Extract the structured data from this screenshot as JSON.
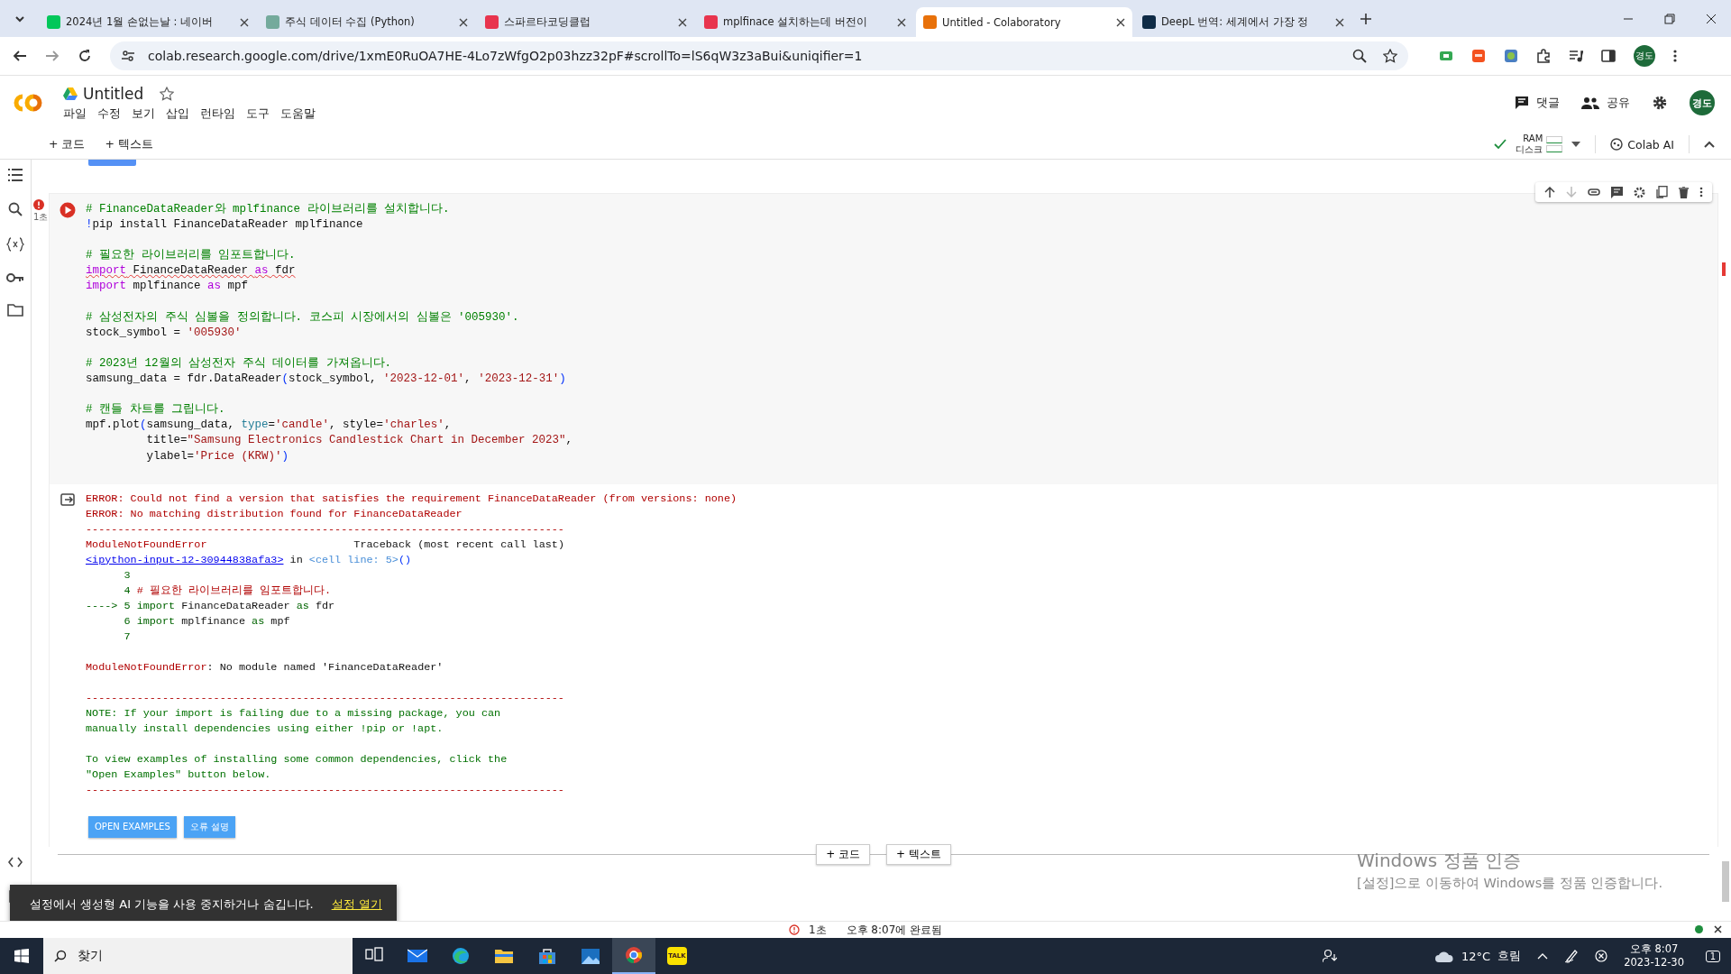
{
  "browser": {
    "tabs": [
      {
        "title": "2024년 1월 손없는날 : 네이버",
        "selected": false,
        "color": "#03c75a"
      },
      {
        "title": "주식 데이터 수집 (Python)",
        "selected": false,
        "color": "#74aa9c"
      },
      {
        "title": "스파르타코딩클럽",
        "selected": false,
        "color": "#e8344e"
      },
      {
        "title": "mplfinace 설치하는데 버전이",
        "selected": false,
        "color": "#e8344e"
      },
      {
        "title": "Untitled - Colaboratory",
        "selected": true,
        "color": "#e8710a"
      },
      {
        "title": "DeepL 번역: 세계에서 가장 정",
        "selected": false,
        "color": "#0f2b46"
      }
    ],
    "url": "colab.research.google.com/drive/1xmE0RuOA7HE-4Lo7zWfgO2p03hzz32pF#scrollTo=lS6qW3z3aBui&uniqifier=1",
    "profile": "경도"
  },
  "notebook": {
    "title": "Untitled",
    "starred": false,
    "menu": [
      "파일",
      "수정",
      "보기",
      "삽입",
      "런타임",
      "도구",
      "도움말"
    ],
    "comment": "댓글",
    "share": "공유",
    "avatar": "경도"
  },
  "toolbar": {
    "add_code": "+ 코드",
    "add_text": "+ 텍스트",
    "ram": "RAM",
    "disk": "디스크",
    "connected": true,
    "ai": "Colab AI"
  },
  "cell": {
    "status": "1초",
    "has_error": true,
    "blocks": [
      [
        [
          {
            "kind": "comment",
            "text": "# FinanceDataReader와 mplfinance 라이브러리를 설치합니다."
          }
        ],
        [
          {
            "kind": "bang",
            "text": "!"
          },
          {
            "kind": "plain",
            "text": "pip install FinanceDataReader mplfinance"
          }
        ]
      ],
      [
        [
          {
            "kind": "comment",
            "text": "# 필요한 라이브러리를 임포트합니다."
          }
        ],
        [
          {
            "kind": "keyword",
            "text": "import",
            "squiggle": true
          },
          {
            "kind": "plain",
            "text": " FinanceDataReader ",
            "squiggle": true
          },
          {
            "kind": "keyword",
            "text": "as",
            "squiggle": true
          },
          {
            "kind": "plain",
            "text": " fdr",
            "squiggle": true
          }
        ],
        [
          {
            "kind": "keyword",
            "text": "import"
          },
          {
            "kind": "plain",
            "text": " mplfinance "
          },
          {
            "kind": "keyword",
            "text": "as"
          },
          {
            "kind": "plain",
            "text": " mpf"
          }
        ]
      ],
      [
        [
          {
            "kind": "comment",
            "text": "# 삼성전자의 주식 심볼을 정의합니다. 코스피 시장에서의 심볼은 '005930'."
          }
        ],
        [
          {
            "kind": "plain",
            "text": "stock_symbol = "
          },
          {
            "kind": "string",
            "text": "'005930'"
          }
        ]
      ],
      [
        [
          {
            "kind": "comment",
            "text": "# 2023년 12월의 삼성전자 주식 데이터를 가져옵니다."
          }
        ],
        [
          {
            "kind": "plain",
            "text": "samsung_data = fdr.DataReader"
          },
          {
            "kind": "paren",
            "text": "("
          },
          {
            "kind": "plain",
            "text": "stock_symbol, "
          },
          {
            "kind": "string",
            "text": "'2023-12-01'"
          },
          {
            "kind": "plain",
            "text": ", "
          },
          {
            "kind": "string",
            "text": "'2023-12-31'"
          },
          {
            "kind": "paren",
            "text": ")"
          }
        ]
      ],
      [
        [
          {
            "kind": "comment",
            "text": "# 캔들 차트를 그립니다."
          }
        ],
        [
          {
            "kind": "plain",
            "text": "mpf.plot"
          },
          {
            "kind": "paren",
            "text": "("
          },
          {
            "kind": "plain",
            "text": "samsung_data, "
          },
          {
            "kind": "param",
            "text": "type"
          },
          {
            "kind": "plain",
            "text": "="
          },
          {
            "kind": "string",
            "text": "'candle'"
          },
          {
            "kind": "plain",
            "text": ", style="
          },
          {
            "kind": "string",
            "text": "'charles'"
          },
          {
            "kind": "plain",
            "text": ","
          }
        ],
        [
          {
            "kind": "plain",
            "text": "         title="
          },
          {
            "kind": "string",
            "text": "\"Samsung Electronics Candlestick Chart in December 2023\""
          },
          {
            "kind": "plain",
            "text": ","
          }
        ],
        [
          {
            "kind": "plain",
            "text": "         ylabel="
          },
          {
            "kind": "string",
            "text": "'Price (KRW)'"
          },
          {
            "kind": "paren",
            "text": ")"
          }
        ]
      ]
    ]
  },
  "output": {
    "blocks": [
      [
        [
          {
            "kind": "error",
            "text": "ERROR: Could not find a version that satisfies the requirement FinanceDataReader (from versions: none)"
          }
        ],
        [
          {
            "kind": "error",
            "text": "ERROR: No matching distribution found for FinanceDataReader"
          }
        ],
        [
          {
            "kind": "error",
            "text": "---------------------------------------------------------------------------"
          }
        ],
        [
          {
            "kind": "error",
            "text": "ModuleNotFoundError"
          },
          {
            "kind": "plain",
            "text": "                       Traceback (most recent call last)"
          }
        ],
        [
          {
            "kind": "link",
            "text": "<ipython-input-12-30944838afa3>"
          },
          {
            "kind": "plain",
            "text": " in "
          },
          {
            "kind": "ref",
            "text": "<cell line: 5>"
          },
          {
            "kind": "paren",
            "text": "()"
          }
        ],
        [
          {
            "kind": "lineno",
            "text": "      3"
          }
        ],
        [
          {
            "kind": "lineno",
            "text": "      4 "
          },
          {
            "kind": "error",
            "text": "# 필요한 라이브러리를 임포트합니다."
          }
        ],
        [
          {
            "kind": "lineno",
            "text": "----> 5 import"
          },
          {
            "kind": "plain",
            "text": " FinanceDataReader "
          },
          {
            "kind": "lineno",
            "text": "as"
          },
          {
            "kind": "plain",
            "text": " fdr"
          }
        ],
        [
          {
            "kind": "lineno",
            "text": "      6 import"
          },
          {
            "kind": "plain",
            "text": " mplfinance "
          },
          {
            "kind": "lineno",
            "text": "as"
          },
          {
            "kind": "plain",
            "text": " mpf"
          }
        ],
        [
          {
            "kind": "lineno",
            "text": "      7"
          }
        ]
      ],
      [
        [
          {
            "kind": "error",
            "text": "ModuleNotFoundError"
          },
          {
            "kind": "plain",
            "text": ": No module named 'FinanceDataReader'"
          }
        ]
      ],
      [
        [
          {
            "kind": "error",
            "text": "---------------------------------------------------------------------------"
          }
        ],
        [
          {
            "kind": "note",
            "text": "NOTE: If your import is failing due to a missing package, you can"
          }
        ],
        [
          {
            "kind": "note",
            "text": "manually install dependencies using either !pip or !apt."
          }
        ]
      ],
      [
        [
          {
            "kind": "note",
            "text": "To view examples of installing some common dependencies, click the"
          }
        ],
        [
          {
            "kind": "note",
            "text": "\"Open Examples\" button below."
          }
        ],
        [
          {
            "kind": "error",
            "text": "---------------------------------------------------------------------------"
          }
        ]
      ]
    ],
    "buttons": [
      "OPEN EXAMPLES",
      "오류 설명"
    ]
  },
  "add_cell": [
    "+ 코드",
    "+ 텍스트"
  ],
  "activation": {
    "title": "Windows 정품 인증",
    "message": "[설정]으로 이동하여 Windows를 정품 인증합니다."
  },
  "toast": {
    "message": "설정에서 생성형 AI 기능을 사용 중지하거나 숨깁니다.",
    "link": "설정 열기"
  },
  "status_bar": {
    "duration": "1초",
    "completed": "오후 8:07에 완료됨"
  },
  "taskbar": {
    "search": "찾기",
    "apps": [
      {
        "kind": "task-view",
        "selected": false
      },
      {
        "kind": "mail",
        "selected": false
      },
      {
        "kind": "edge",
        "selected": false
      },
      {
        "kind": "folder",
        "selected": false
      },
      {
        "kind": "store",
        "selected": false
      },
      {
        "kind": "photos",
        "selected": false
      },
      {
        "kind": "chrome",
        "selected": true
      },
      {
        "kind": "talk",
        "label": "TALK",
        "selected": false
      }
    ],
    "temperature": "12°C",
    "weather": "흐림",
    "time": "오후 8:07",
    "date": "2023-12-30",
    "notifications": "1"
  }
}
